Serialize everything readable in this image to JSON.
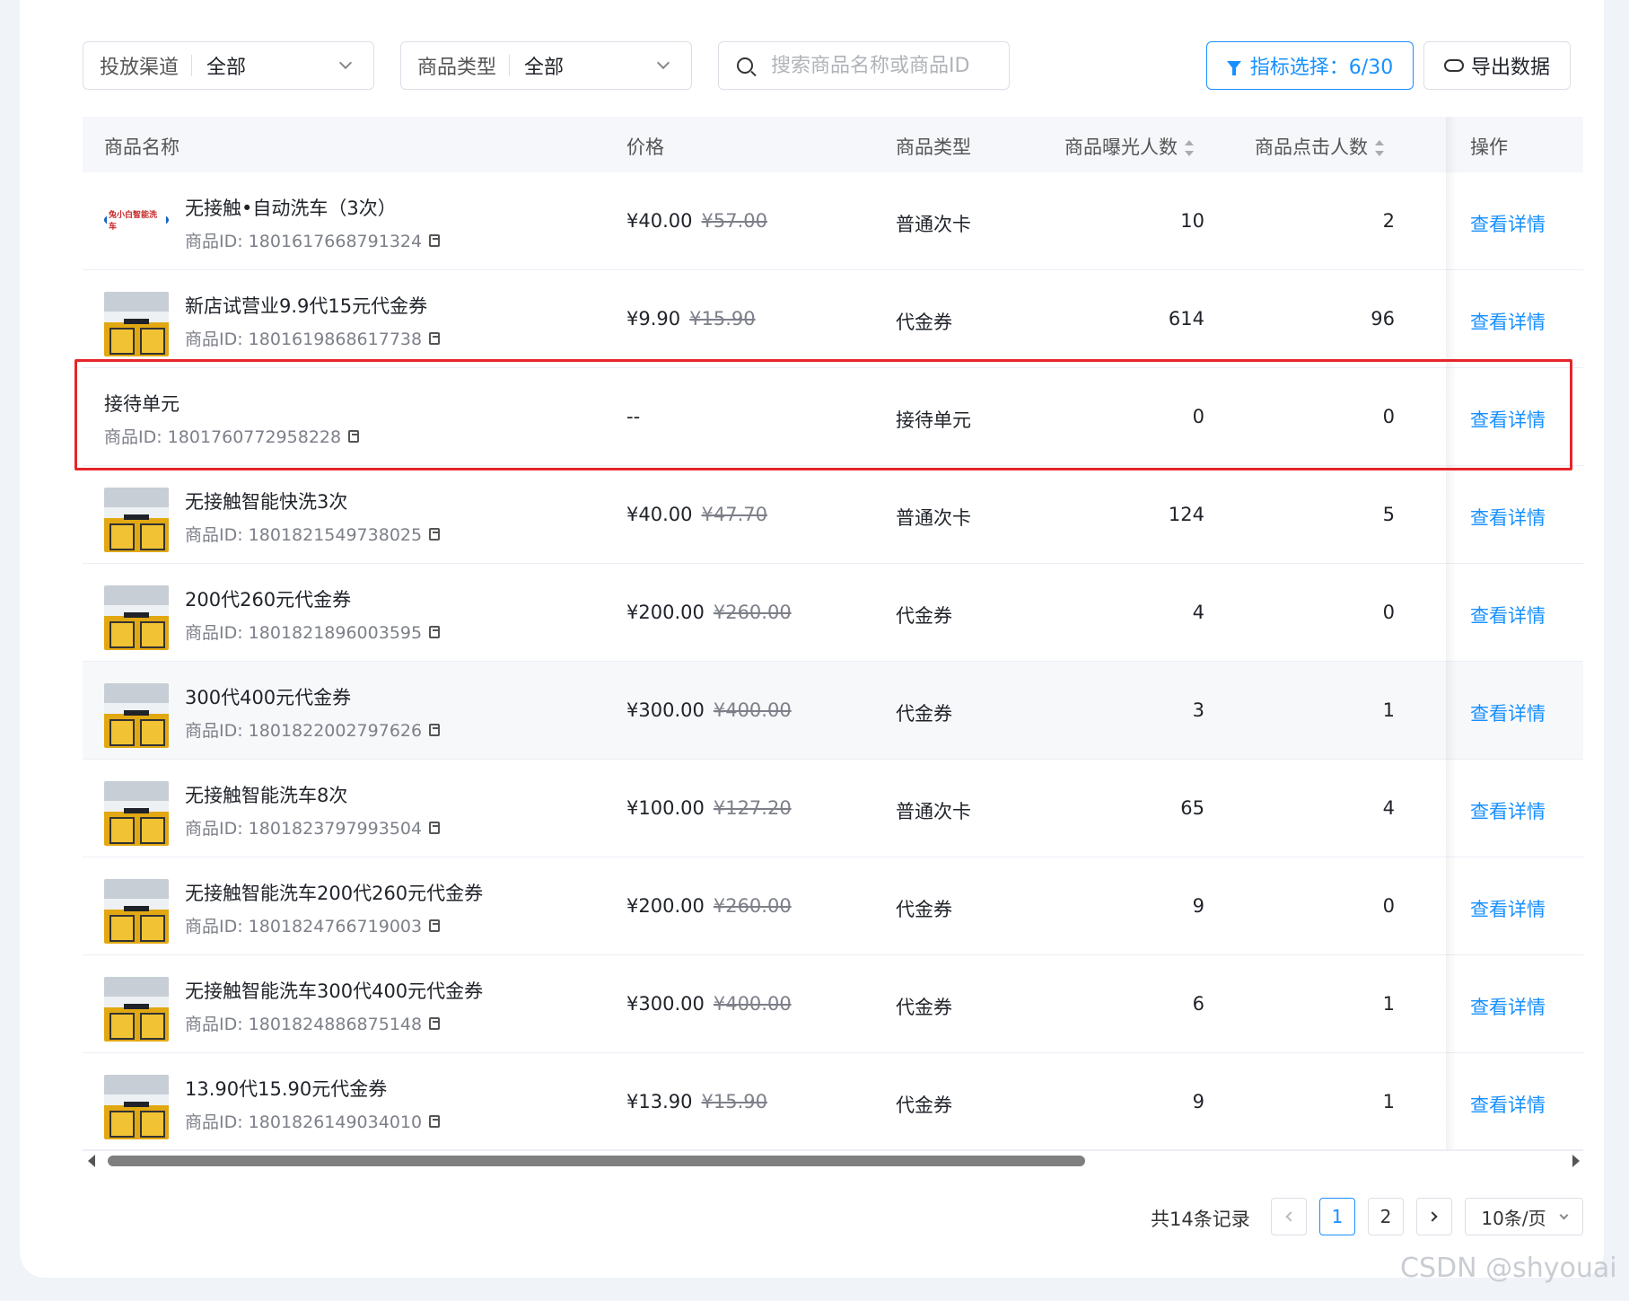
{
  "filters": {
    "channel": {
      "label": "投放渠道",
      "value": "全部"
    },
    "type": {
      "label": "商品类型",
      "value": "全部"
    },
    "search": {
      "placeholder": "搜索商品名称或商品ID"
    },
    "metric_button": "指标选择：6/30",
    "export_button": "导出数据"
  },
  "table": {
    "headers": {
      "name": "商品名称",
      "price": "价格",
      "type": "商品类型",
      "exposure": "商品曝光人数",
      "clicks": "商品点击人数",
      "actions": "操作"
    },
    "rows": [
      {
        "name": "无接触•自动洗车（3次）",
        "id": "商品ID: 1801617668791324",
        "price": "¥40.00",
        "orig": "¥57.00",
        "type": "普通次卡",
        "exposure": "10",
        "clicks": "2",
        "action": "查看详情",
        "thumb": "logo",
        "logo_text": "兔小白智能洗车"
      },
      {
        "name": "新店试营业9.9代15元代金券",
        "id": "商品ID: 1801619868617738",
        "price": "¥9.90",
        "orig": "¥15.90",
        "type": "代金券",
        "exposure": "614",
        "clicks": "96",
        "action": "查看详情",
        "thumb": "photo"
      },
      {
        "name": "接待单元",
        "id": "商品ID: 1801760772958228",
        "price": "--",
        "orig": "",
        "type": "接待单元",
        "exposure": "0",
        "clicks": "0",
        "action": "查看详情",
        "thumb": "none"
      },
      {
        "name": "无接触智能快洗3次",
        "id": "商品ID: 1801821549738025",
        "price": "¥40.00",
        "orig": "¥47.70",
        "type": "普通次卡",
        "exposure": "124",
        "clicks": "5",
        "action": "查看详情",
        "thumb": "photo"
      },
      {
        "name": "200代260元代金券",
        "id": "商品ID: 1801821896003595",
        "price": "¥200.00",
        "orig": "¥260.00",
        "type": "代金券",
        "exposure": "4",
        "clicks": "0",
        "action": "查看详情",
        "thumb": "photo"
      },
      {
        "name": "300代400元代金券",
        "id": "商品ID: 1801822002797626",
        "price": "¥300.00",
        "orig": "¥400.00",
        "type": "代金券",
        "exposure": "3",
        "clicks": "1",
        "action": "查看详情",
        "thumb": "photo"
      },
      {
        "name": "无接触智能洗车8次",
        "id": "商品ID: 1801823797993504",
        "price": "¥100.00",
        "orig": "¥127.20",
        "type": "普通次卡",
        "exposure": "65",
        "clicks": "4",
        "action": "查看详情",
        "thumb": "photo"
      },
      {
        "name": "无接触智能洗车200代260元代金券",
        "id": "商品ID: 1801824766719003",
        "price": "¥200.00",
        "orig": "¥260.00",
        "type": "代金券",
        "exposure": "9",
        "clicks": "0",
        "action": "查看详情",
        "thumb": "photo"
      },
      {
        "name": "无接触智能洗车300代400元代金券",
        "id": "商品ID: 1801824886875148",
        "price": "¥300.00",
        "orig": "¥400.00",
        "type": "代金券",
        "exposure": "6",
        "clicks": "1",
        "action": "查看详情",
        "thumb": "photo"
      },
      {
        "name": "13.90代15.90元代金券",
        "id": "商品ID: 1801826149034010",
        "price": "¥13.90",
        "orig": "¥15.90",
        "type": "代金券",
        "exposure": "9",
        "clicks": "1",
        "action": "查看详情",
        "thumb": "photo"
      }
    ]
  },
  "pagination": {
    "total": "共14条记录",
    "pages": [
      "1",
      "2"
    ],
    "current": "1",
    "page_size": "10条/页"
  },
  "watermark": "CSDN @shyouai",
  "colors": {
    "accent": "#1890ff",
    "highlight": "#e5252a"
  }
}
